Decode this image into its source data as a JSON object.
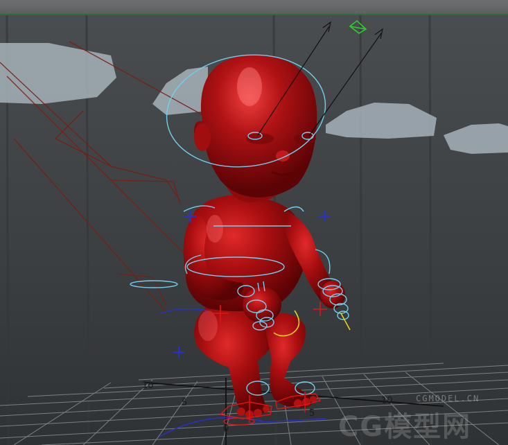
{
  "toolbar": {
    "strip": ""
  },
  "grid": {
    "labels": [
      "10",
      "5",
      "0",
      "5",
      "10"
    ]
  },
  "watermark": {
    "site": "CGMODEL.CN",
    "logo": "CG模型网"
  },
  "colors": {
    "background": "#3c3f42",
    "character": "#9c0b0c",
    "controls_cyan": "#6fd0ee",
    "controls_blue": "#2632c8",
    "controls_red": "#e01515",
    "locator_green": "#29d12a",
    "bone_lines": "#7a1d10"
  }
}
